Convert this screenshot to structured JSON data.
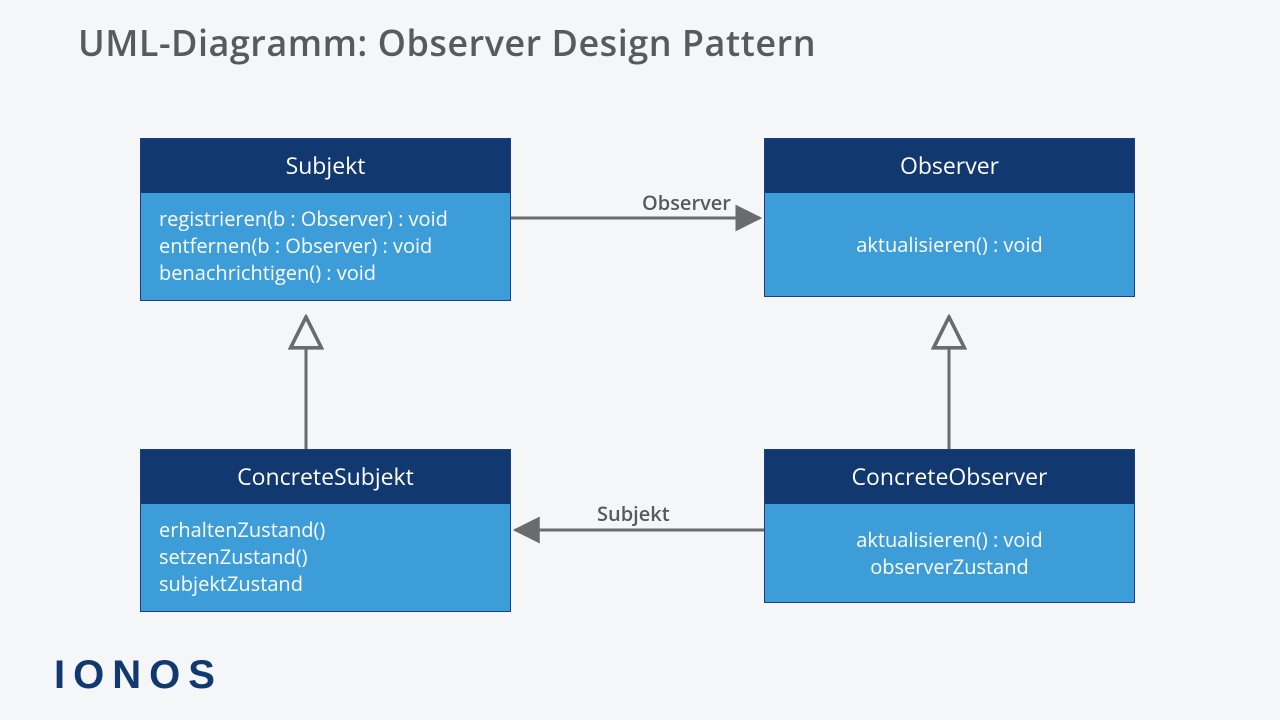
{
  "title": "UML-Diagramm: Observer Design Pattern",
  "boxes": {
    "subject": {
      "name": "Subjekt",
      "methods": [
        "registrieren(b : Observer) : void",
        "entfernen(b : Observer) : void",
        "benachrichtigen() : void"
      ]
    },
    "observer": {
      "name": "Observer",
      "methods": [
        "aktualisieren() : void"
      ]
    },
    "concreteSubject": {
      "name": "ConcreteSubjekt",
      "methods": [
        "erhaltenZustand()",
        "setzenZustand()",
        "subjektZustand"
      ]
    },
    "concreteObserver": {
      "name": "ConcreteObserver",
      "methods": [
        "aktualisieren() : void",
        "observerZustand"
      ]
    }
  },
  "edges": {
    "subjectToObserver": "Observer",
    "concreteObserverToConcreteSubject": "Subjekt"
  },
  "logo": "IONOS"
}
